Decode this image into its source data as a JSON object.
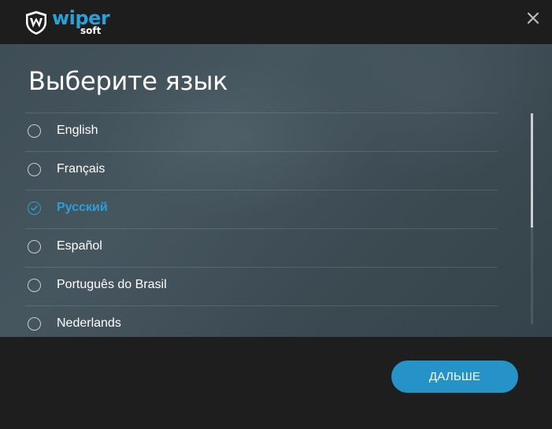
{
  "header": {
    "logo_brand": "wiper",
    "logo_sub": "soft"
  },
  "main": {
    "title": "Выберите язык",
    "languages": [
      {
        "label": "English",
        "selected": false
      },
      {
        "label": "Français",
        "selected": false
      },
      {
        "label": "Русский",
        "selected": true
      },
      {
        "label": "Español",
        "selected": false
      },
      {
        "label": "Português do Brasil",
        "selected": false
      },
      {
        "label": "Nederlands",
        "selected": false
      }
    ]
  },
  "footer": {
    "next_label": "ДАЛЬШЕ"
  },
  "colors": {
    "accent": "#2a9fd8",
    "button": "#2592c8",
    "header_bg": "#1d1d1d",
    "panel_bg": "#404f58"
  }
}
